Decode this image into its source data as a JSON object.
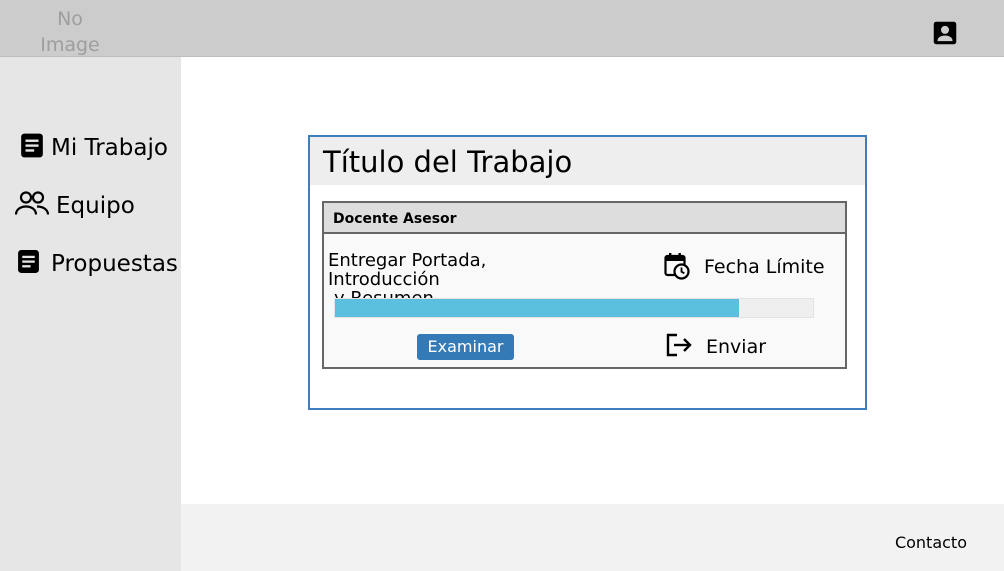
{
  "header": {
    "logo_line1": "No",
    "logo_line2": "Image",
    "user_icon": "account-box-icon"
  },
  "sidebar": {
    "items": [
      {
        "label": "Mi Trabajo",
        "icon": "document-icon"
      },
      {
        "label": "Equipo",
        "icon": "people-icon"
      },
      {
        "label": "Propuestas",
        "icon": "document-icon"
      }
    ]
  },
  "card": {
    "title": "Título del Trabajo",
    "panel": {
      "header": "Docente Asesor",
      "task_line1": "Entregar Portada, Introducción",
      "task_line2": "y Resumen",
      "deadline_label": "Fecha Límite",
      "deadline_icon": "calendar-clock-icon",
      "progress_fraction": 0.845,
      "examine_button": "Examinar",
      "send_label": "Enviar",
      "send_icon": "exit-arrow-icon"
    }
  },
  "footer": {
    "contact": "Contacto"
  },
  "colors": {
    "topbar": "#cccccc",
    "sidebar": "#e6e6e6",
    "card_border": "#3d7ebf",
    "progress": "#5bc0de",
    "button": "#337ab7"
  }
}
